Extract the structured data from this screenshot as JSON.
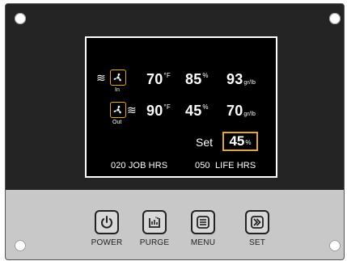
{
  "panel": {
    "lcd": {
      "inlet": {
        "fan_label": "In",
        "temp": "70",
        "temp_unit": "°F",
        "humidity": "85",
        "humidity_unit": "%",
        "grains": "93",
        "grains_unit": "gr/lb",
        "fan_icon": "fan-icon",
        "wind_icon": "airflow-icon"
      },
      "outlet": {
        "fan_label": "Out",
        "temp": "90",
        "temp_unit": "°F",
        "humidity": "45",
        "humidity_unit": "%",
        "grains": "70",
        "grains_unit": "gr/lb",
        "fan_icon": "fan-icon",
        "wind_icon": "airflow-icon"
      },
      "setpoint": {
        "label": "Set",
        "value": "45",
        "unit": "%"
      },
      "hours": {
        "job_value": "020",
        "job_label": "JOB HRS",
        "life_value": "050",
        "life_label": "LIFE HRS"
      }
    },
    "buttons": [
      {
        "label": "POWER",
        "icon": "power-icon"
      },
      {
        "label": "PURGE",
        "icon": "purge-icon"
      },
      {
        "label": "MENU",
        "icon": "menu-icon"
      },
      {
        "label": "SET",
        "icon": "forward-icon"
      }
    ],
    "colors": {
      "accent": "#e2a72f",
      "upper_panel": "#242424",
      "lower_panel": "#c8c8c8",
      "lcd_bg": "#000000"
    }
  }
}
